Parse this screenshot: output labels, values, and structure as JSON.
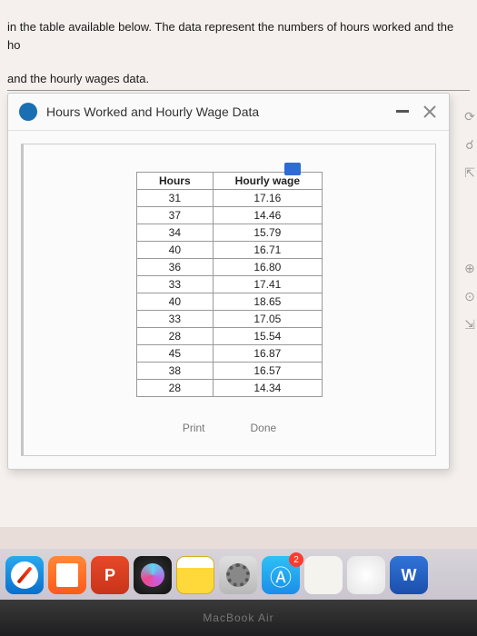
{
  "context": {
    "line1": "in the table available below. The data represent the numbers of hours worked and the ho",
    "line2": "and the hourly wages data."
  },
  "dialog": {
    "title": "Hours Worked and Hourly Wage Data",
    "buttons": {
      "print": "Print",
      "done": "Done"
    }
  },
  "chart_data": {
    "type": "table",
    "columns": [
      "Hours",
      "Hourly wage"
    ],
    "rows": [
      [
        "31",
        "17.16"
      ],
      [
        "37",
        "14.46"
      ],
      [
        "34",
        "15.79"
      ],
      [
        "40",
        "16.71"
      ],
      [
        "36",
        "16.80"
      ],
      [
        "33",
        "17.41"
      ],
      [
        "40",
        "18.65"
      ],
      [
        "33",
        "17.05"
      ],
      [
        "28",
        "15.54"
      ],
      [
        "45",
        "16.87"
      ],
      [
        "38",
        "16.57"
      ],
      [
        "28",
        "14.34"
      ]
    ]
  },
  "dock": {
    "appstore_badge": "2",
    "ppt_label": "P",
    "word_label": "W"
  },
  "laptop_label": "MacBook Air"
}
